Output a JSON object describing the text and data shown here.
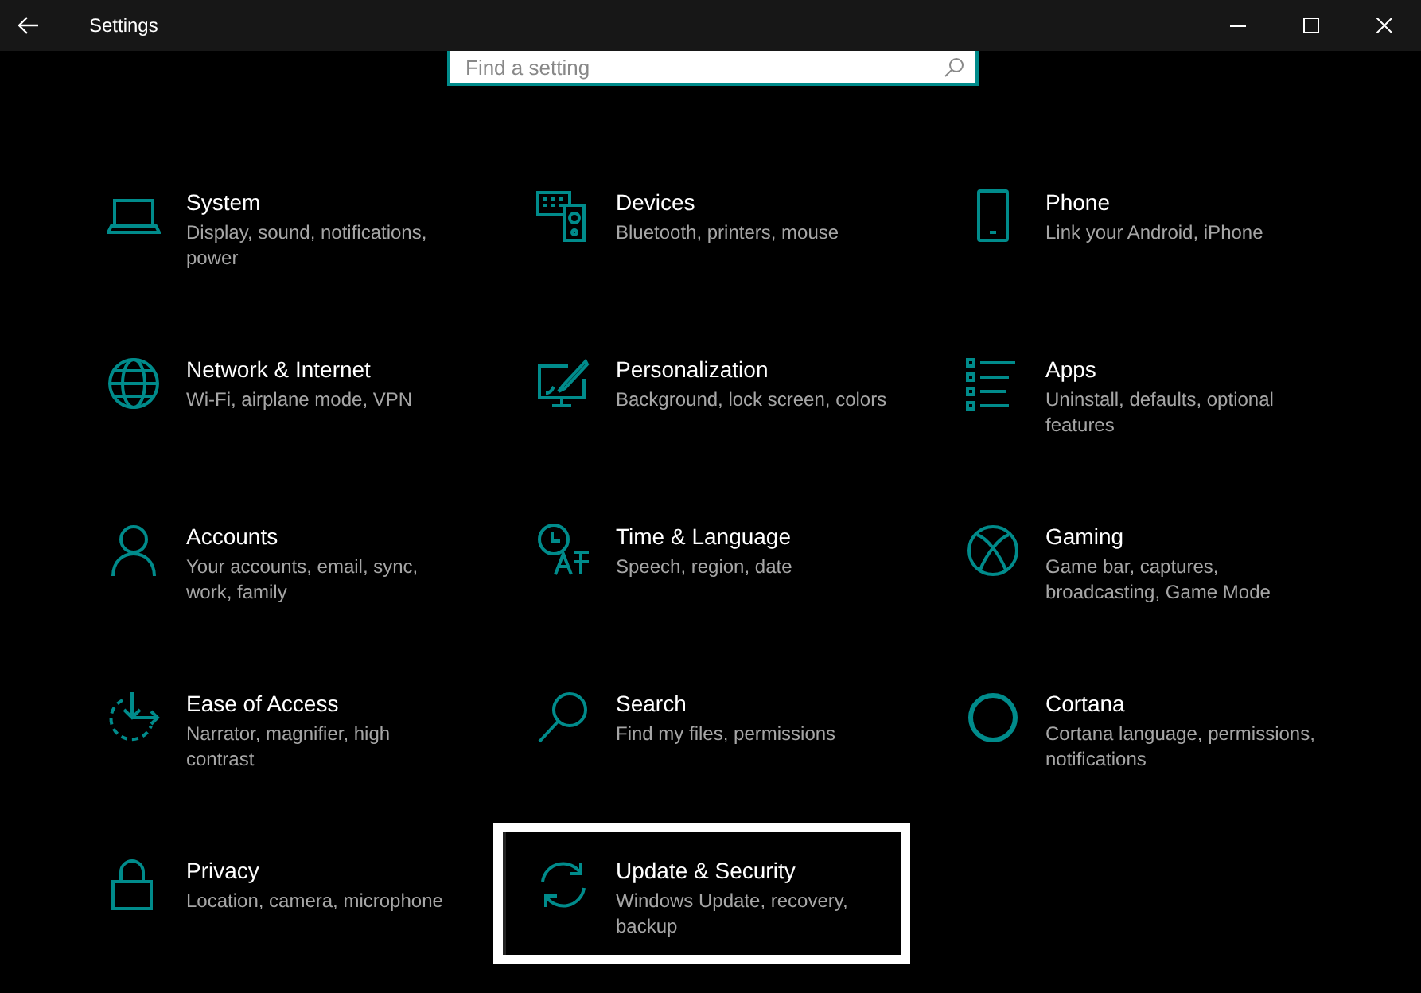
{
  "window": {
    "title": "Settings"
  },
  "search": {
    "placeholder": "Find a setting"
  },
  "tiles": [
    {
      "title": "System",
      "description": "Display, sound, notifications, power",
      "selected": false
    },
    {
      "title": "Devices",
      "description": "Bluetooth, printers, mouse",
      "selected": false
    },
    {
      "title": "Phone",
      "description": "Link your Android, iPhone",
      "selected": false
    },
    {
      "title": "Network & Internet",
      "description": "Wi-Fi, airplane mode, VPN",
      "selected": false
    },
    {
      "title": "Personalization",
      "description": "Background, lock screen, colors",
      "selected": false
    },
    {
      "title": "Apps",
      "description": "Uninstall, defaults, optional features",
      "selected": false
    },
    {
      "title": "Accounts",
      "description": "Your accounts, email, sync, work, family",
      "selected": false
    },
    {
      "title": "Time & Language",
      "description": "Speech, region, date",
      "selected": false
    },
    {
      "title": "Gaming",
      "description": "Game bar, captures, broadcasting, Game Mode",
      "selected": false
    },
    {
      "title": "Ease of Access",
      "description": "Narrator, magnifier, high contrast",
      "selected": false
    },
    {
      "title": "Search",
      "description": "Find my files, permissions",
      "selected": false
    },
    {
      "title": "Cortana",
      "description": "Cortana language, permissions, notifications",
      "selected": false
    },
    {
      "title": "Privacy",
      "description": "Location, camera, microphone",
      "selected": false
    },
    {
      "title": "Update & Security",
      "description": "Windows Update, recovery, backup",
      "selected": true
    }
  ]
}
